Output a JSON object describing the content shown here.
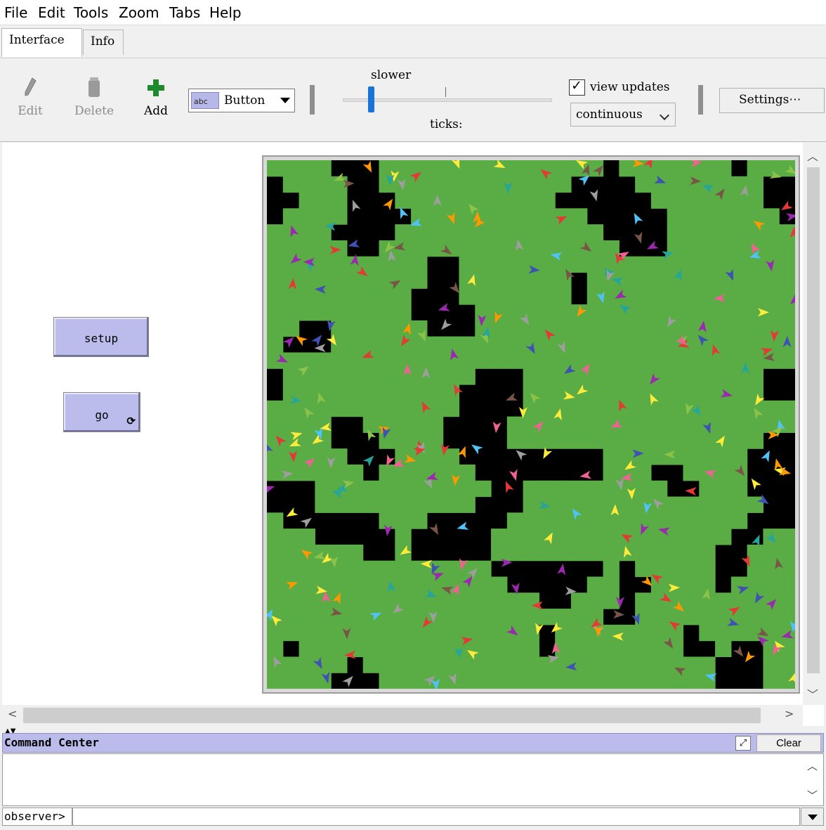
{
  "menu": [
    "File",
    "Edit",
    "Tools",
    "Zoom",
    "Tabs",
    "Help"
  ],
  "tabs": [
    {
      "label": "Interface",
      "active": true
    },
    {
      "label": "Info",
      "active": false
    }
  ],
  "toolbar": {
    "edit_label": "Edit",
    "delete_label": "Delete",
    "add_label": "Add",
    "widget_type": "Button",
    "widget_icon_text": "abc",
    "speed_label": "slower",
    "ticks_label": "ticks:",
    "view_updates_label": "view updates",
    "view_updates_checked": true,
    "update_mode": "continuous",
    "settings_label": "Settings⋯"
  },
  "widgets": {
    "setup_label": "setup",
    "go_label": "go",
    "go_forever": true
  },
  "world": {
    "grid_size": 33,
    "colors": {
      "grass": "#5aac44",
      "dirt": "#000000"
    },
    "turtle_colors": [
      "#e53935",
      "#4fc3f7",
      "#ff9800",
      "#ffeb3b",
      "#9c27b0",
      "#26a69a",
      "#f06292",
      "#795548",
      "#3f51b5",
      "#8bc34a",
      "#9e9e9e"
    ],
    "turtle_count": 300
  },
  "command_center": {
    "title": "Command Center",
    "clear_label": "Clear",
    "prompt": "observer>",
    "input_value": ""
  },
  "colors": {
    "button_bg": "#bcbcec",
    "accent": "#1a73d9"
  }
}
